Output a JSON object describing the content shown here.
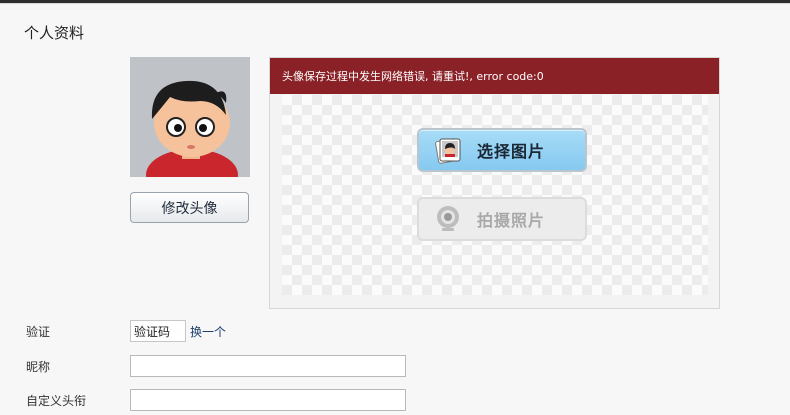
{
  "page": {
    "title": "个人资料"
  },
  "avatar": {
    "change_label": "修改头像"
  },
  "uploader": {
    "error_message": "头像保存过程中发生网络错误, 请重试!, error code:0",
    "select_photo_label": "选择图片",
    "take_photo_label": "拍摄照片"
  },
  "form": {
    "captcha_label": "验证",
    "captcha_value": "验证码",
    "refresh_label": "换一个",
    "nickname_label": "昵称",
    "nickname_value": "",
    "custom_title_label": "自定义头衔",
    "custom_title_value": ""
  }
}
